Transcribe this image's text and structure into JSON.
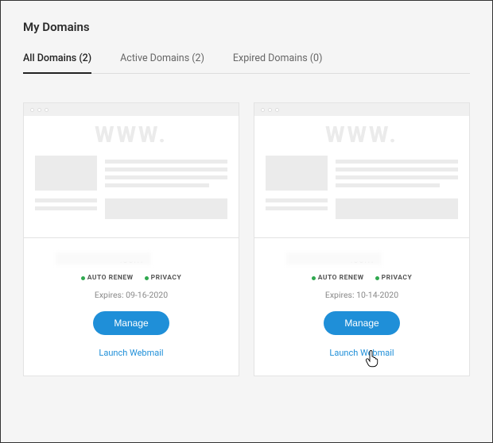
{
  "page": {
    "title": "My Domains"
  },
  "tabs": {
    "all": "All Domains (2)",
    "active": "Active Domains (2)",
    "expired": "Expired Domains (0)"
  },
  "card0": {
    "domain": ".com",
    "auto_renew": "AUTO RENEW",
    "privacy": "PRIVACY",
    "expires": "Expires: 09-16-2020",
    "manage": "Manage",
    "webmail": "Launch Webmail"
  },
  "card1": {
    "domain": ".com",
    "auto_renew": "AUTO RENEW",
    "privacy": "PRIVACY",
    "expires": "Expires: 10-14-2020",
    "manage": "Manage",
    "webmail": "Launch Webmail"
  },
  "thumb": {
    "www": "WWW."
  }
}
